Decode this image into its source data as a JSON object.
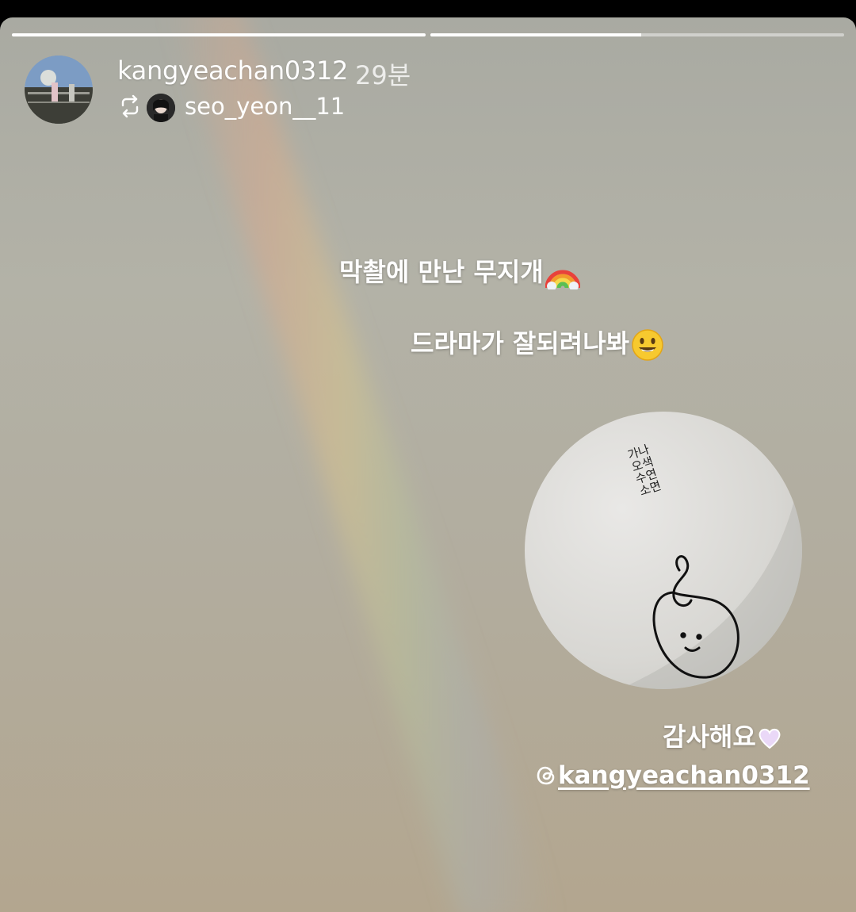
{
  "story": {
    "progress": [
      1.0,
      0.51
    ],
    "username": "kangyeachan0312",
    "time_ago": "29분",
    "repost_from": "seo_yeon__11"
  },
  "captions": {
    "line1": "막촬에 만난 무지개",
    "line1_emoji": "rainbow",
    "line2": "드라마가 잘되려나봐",
    "line2_emoji": "smiley-face",
    "thanks": "감사해요",
    "thanks_emoji": "light-purple-heart"
  },
  "sticker": {
    "handwritten_text": "가나오색수연소면",
    "mention_handle": "kangyeachan0312",
    "mention_icon": "threads-icon"
  },
  "colors": {
    "progress_fill": "#ffffff",
    "progress_track": "rgba(255,255,255,0.45)",
    "heart": "#e8d6f5"
  }
}
